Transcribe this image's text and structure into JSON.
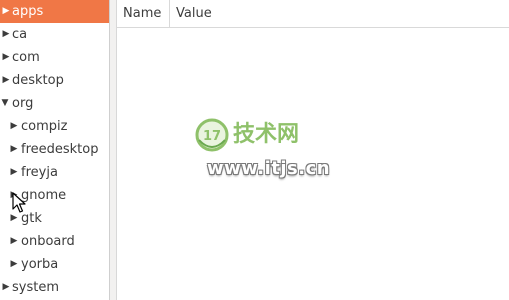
{
  "tree": {
    "items": [
      {
        "label": "apps",
        "toggle": "▶",
        "selected": true
      },
      {
        "label": "ca",
        "toggle": "▶"
      },
      {
        "label": "com",
        "toggle": "▶"
      },
      {
        "label": "desktop",
        "toggle": "▶"
      },
      {
        "label": "org",
        "toggle": "▼"
      },
      {
        "label": "compiz",
        "toggle": "▶"
      },
      {
        "label": "freedesktop",
        "toggle": "▶"
      },
      {
        "label": "freyja",
        "toggle": "▶"
      },
      {
        "label": "gnome",
        "toggle": "▶"
      },
      {
        "label": "gtk",
        "toggle": "▶"
      },
      {
        "label": "onboard",
        "toggle": "▶"
      },
      {
        "label": "yorba",
        "toggle": "▶"
      },
      {
        "label": "system",
        "toggle": "▶"
      }
    ]
  },
  "list": {
    "columns": [
      {
        "label": "Name"
      },
      {
        "label": "Value"
      }
    ]
  },
  "watermark": {
    "logo_text": "17",
    "title": "技术网",
    "url": "www.itjs.cn"
  },
  "colors": {
    "selection": "#f07746",
    "watermark_green": "#8fc16a"
  }
}
